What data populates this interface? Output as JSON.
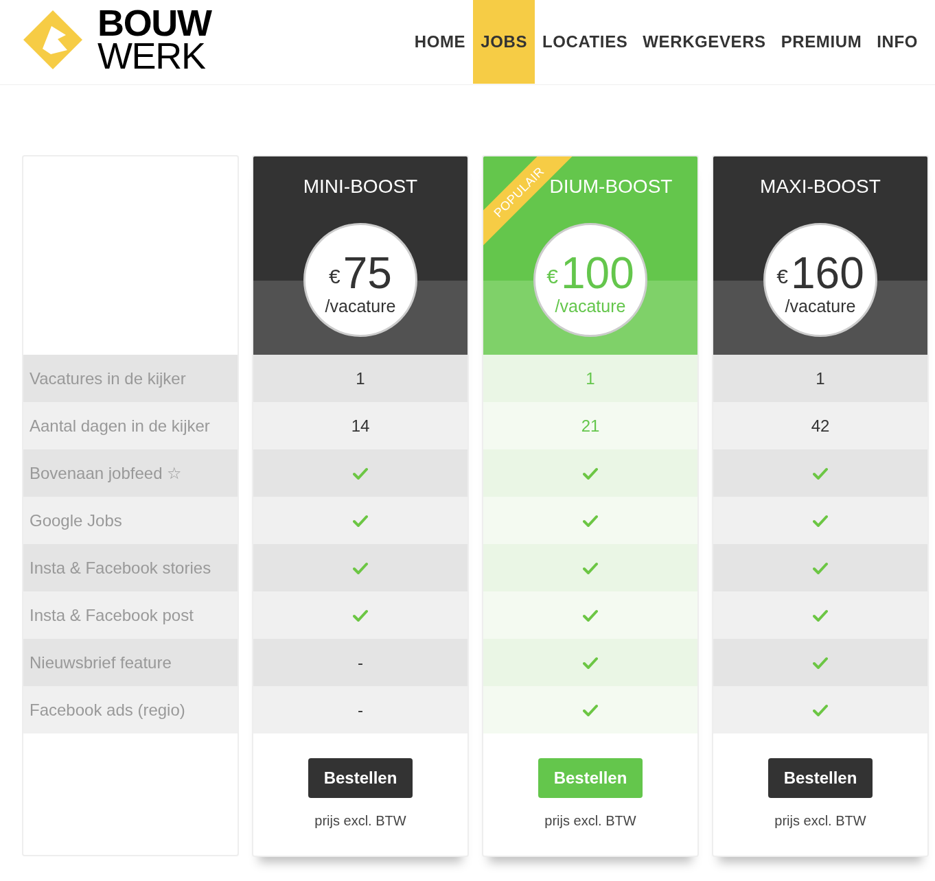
{
  "logo": {
    "line_1": "BOUW",
    "line_2": "WERK"
  },
  "nav": [
    {
      "label": "HOME",
      "selected": false
    },
    {
      "label": "JOBS",
      "selected": true
    },
    {
      "label": "LOCATIES",
      "selected": false
    },
    {
      "label": "WERKGEVERS",
      "selected": false
    },
    {
      "label": "PREMIUM",
      "selected": false
    },
    {
      "label": "INFO",
      "selected": false
    }
  ],
  "features": [
    "Vacatures in de kijker",
    "Aantal dagen in de kijker",
    "Bovenaan jobfeed ☆",
    "Google Jobs",
    "Insta & Facebook stories",
    "Insta & Facebook post",
    "Nieuwsbrief feature",
    "Facebook ads (regio)"
  ],
  "plans": [
    {
      "title": "MINI-BOOST",
      "featured": false,
      "currency": "€",
      "price": "75",
      "unit": "/vacature",
      "cells": [
        {
          "kind": "text",
          "text": "1"
        },
        {
          "kind": "text",
          "text": "14"
        },
        {
          "kind": "check"
        },
        {
          "kind": "check"
        },
        {
          "kind": "check"
        },
        {
          "kind": "check"
        },
        {
          "kind": "text",
          "text": "-"
        },
        {
          "kind": "text",
          "text": "-"
        }
      ],
      "button": "Bestellen",
      "note": "prijs excl. BTW"
    },
    {
      "title": "DIUM-BOOST",
      "featured": true,
      "ribbon": "POPULAIR",
      "currency": "€",
      "price": "100",
      "unit": "/vacature",
      "cells": [
        {
          "kind": "text",
          "text": "1"
        },
        {
          "kind": "text",
          "text": "21"
        },
        {
          "kind": "check"
        },
        {
          "kind": "check"
        },
        {
          "kind": "check"
        },
        {
          "kind": "check"
        },
        {
          "kind": "check"
        },
        {
          "kind": "check"
        }
      ],
      "button": "Bestellen",
      "note": "prijs excl. BTW"
    },
    {
      "title": "MAXI-BOOST",
      "featured": false,
      "currency": "€",
      "price": "160",
      "unit": "/vacature",
      "cells": [
        {
          "kind": "text",
          "text": "1"
        },
        {
          "kind": "text",
          "text": "42"
        },
        {
          "kind": "check"
        },
        {
          "kind": "check"
        },
        {
          "kind": "check"
        },
        {
          "kind": "check"
        },
        {
          "kind": "check"
        },
        {
          "kind": "check"
        }
      ],
      "button": "Bestellen",
      "note": "prijs excl. BTW"
    }
  ]
}
